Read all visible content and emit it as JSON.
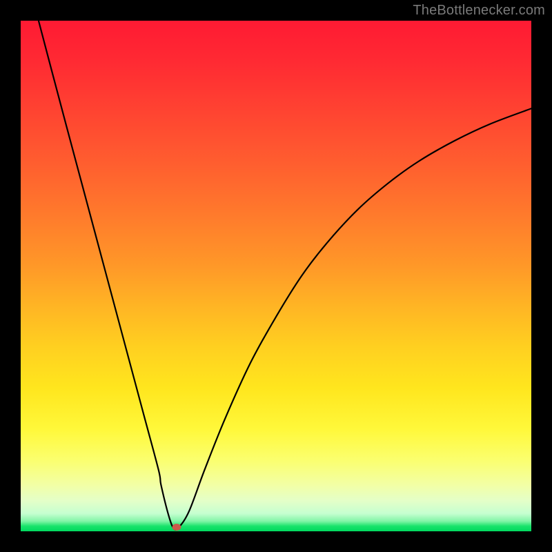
{
  "watermark": "TheBottlenecker.com",
  "chart_data": {
    "type": "line",
    "title": "",
    "xlabel": "",
    "ylabel": "",
    "xlim": [
      0,
      100
    ],
    "ylim": [
      0,
      100
    ],
    "x": [
      3.5,
      6,
      9,
      12,
      15,
      18,
      21,
      24,
      27,
      27.5,
      29,
      30,
      31,
      33,
      36,
      40,
      45,
      50,
      55,
      60,
      66,
      72,
      78,
      85,
      92,
      100
    ],
    "values": [
      100,
      90.5,
      79.2,
      68,
      56.8,
      45.6,
      34.4,
      23.2,
      12,
      9,
      3,
      0.5,
      0.8,
      4,
      12,
      22,
      33,
      42,
      50,
      56.5,
      63,
      68.2,
      72.5,
      76.5,
      79.8,
      82.8
    ],
    "marker": {
      "x": 30.5,
      "y": 0.8
    },
    "background": {
      "type": "vertical-gradient",
      "stops": [
        {
          "pos": 0,
          "color": "#ff1a33"
        },
        {
          "pos": 50,
          "color": "#ff9828"
        },
        {
          "pos": 80,
          "color": "#fff83a"
        },
        {
          "pos": 100,
          "color": "#00d95f"
        }
      ]
    }
  }
}
